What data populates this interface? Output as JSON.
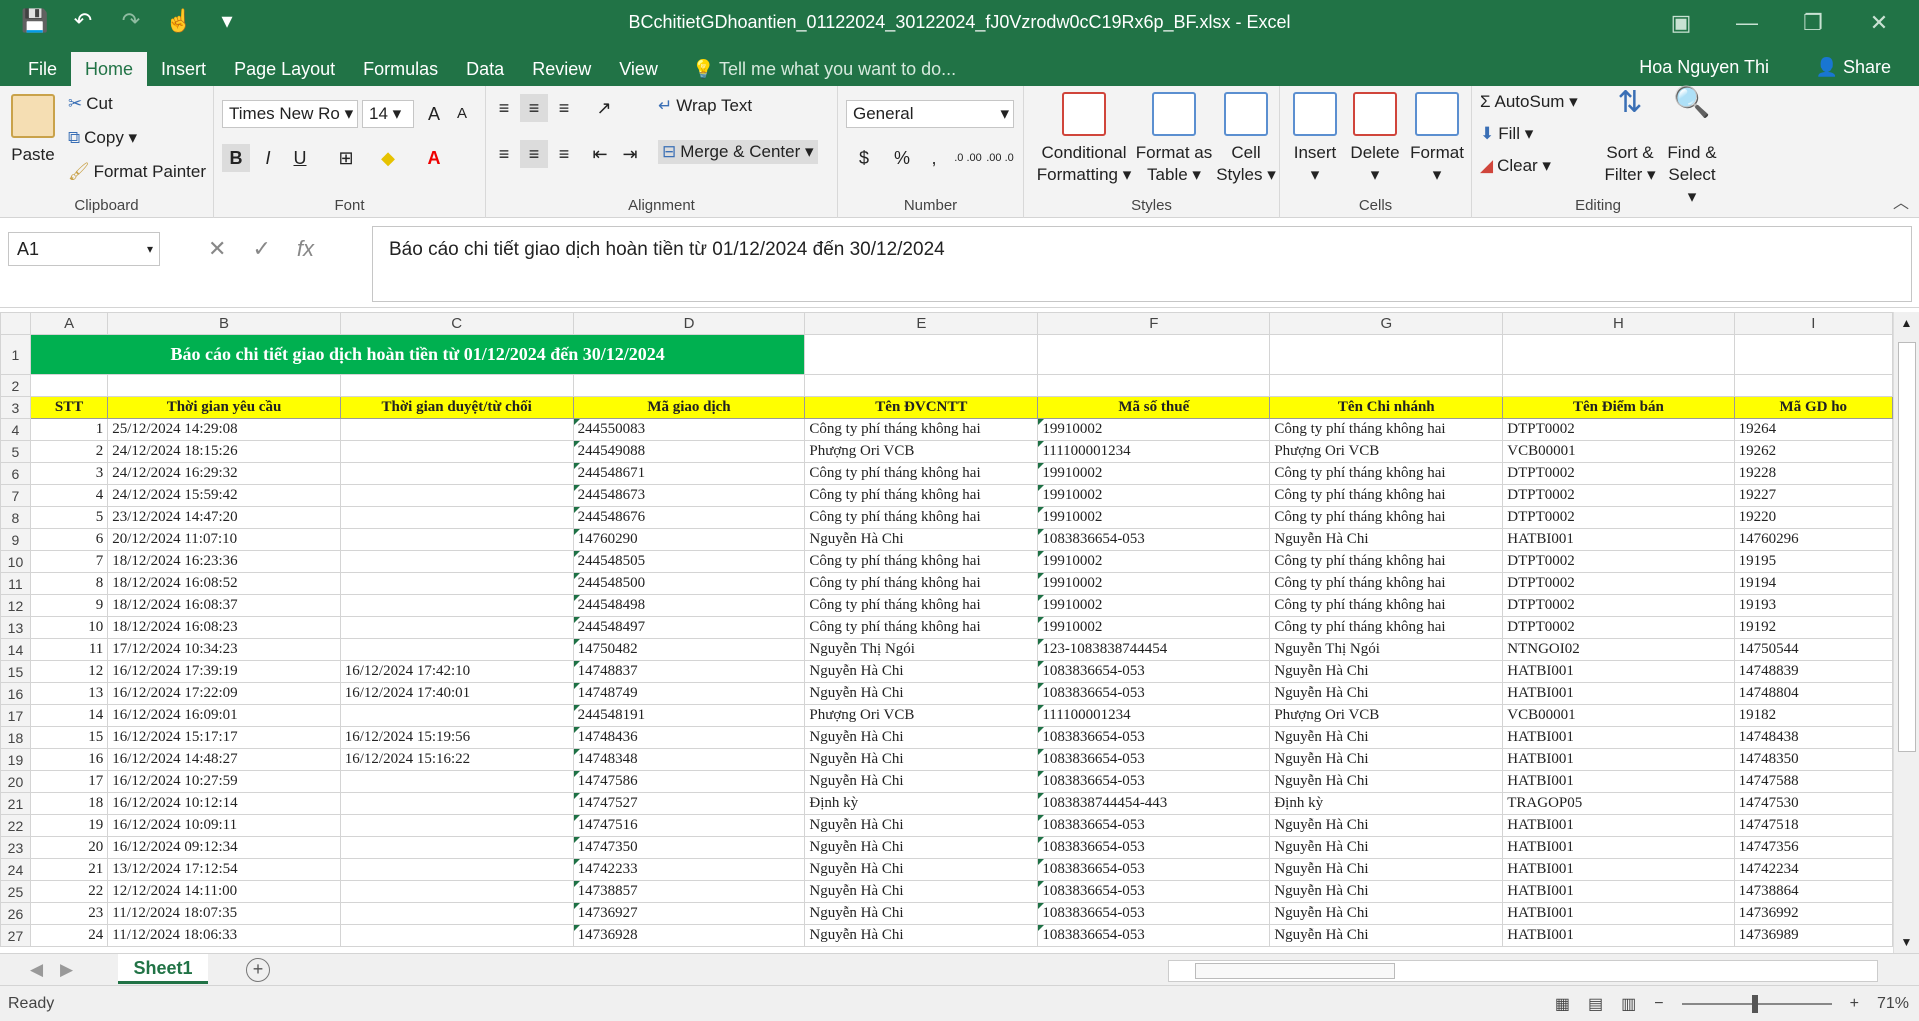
{
  "window": {
    "title": "BCchitietGDhoantien_01122024_30122024_fJ0Vzrodw0cC19Rx6p_BF.xlsx - Excel"
  },
  "qat": {
    "save_icon": "save-icon",
    "undo_icon": "undo-icon",
    "redo_icon": "redo-icon",
    "touch_icon": "touch-mode-icon",
    "customize_icon": "customize-icon"
  },
  "tabs": [
    {
      "label": "File"
    },
    {
      "label": "Home"
    },
    {
      "label": "Insert"
    },
    {
      "label": "Page Layout"
    },
    {
      "label": "Formulas"
    },
    {
      "label": "Data"
    },
    {
      "label": "Review"
    },
    {
      "label": "View"
    }
  ],
  "tell_me": "Tell me what you want to do...",
  "user": "Hoa Nguyen Thi",
  "share": "Share",
  "ribbon": {
    "clipboard": {
      "paste": "Paste",
      "cut": "Cut",
      "copy": "Copy",
      "format_painter": "Format Painter",
      "label": "Clipboard"
    },
    "font": {
      "name": "Times New Ro",
      "size": "14",
      "label": "Font",
      "bold": "B",
      "italic": "I",
      "underline": "U",
      "grow": "A",
      "shrink": "A"
    },
    "alignment": {
      "wrap": "Wrap Text",
      "merge": "Merge & Center",
      "label": "Alignment"
    },
    "number": {
      "format": "General",
      "currency": "$",
      "percent": "%",
      "comma": ",",
      "label": "Number",
      "inc_decimal": ".0 .00",
      "dec_decimal": ".00 .0"
    },
    "styles": {
      "conditional_l1": "Conditional",
      "conditional_l2": "Formatting",
      "table_l1": "Format as",
      "table_l2": "Table",
      "cell_l1": "Cell",
      "cell_l2": "Styles",
      "label": "Styles"
    },
    "cells": {
      "insert": "Insert",
      "delete": "Delete",
      "format": "Format",
      "label": "Cells"
    },
    "editing": {
      "autosum": "AutoSum",
      "fill": "Fill",
      "clear": "Clear",
      "sort_l1": "Sort &",
      "sort_l2": "Filter",
      "find_l1": "Find &",
      "find_l2": "Select",
      "label": "Editing"
    }
  },
  "formula_bar": {
    "name_box": "A1",
    "cancel": "✕",
    "enter": "✓",
    "fx": "fx",
    "value": "Báo cáo chi tiết giao dịch hoàn tiền từ 01/12/2024 đến 30/12/2024"
  },
  "sheet": {
    "columns": [
      "A",
      "B",
      "C",
      "D",
      "E",
      "F",
      "G",
      "H",
      "I"
    ],
    "banner": "Báo cáo chi tiết giao dịch hoàn tiền từ 01/12/2024 đến 30/12/2024",
    "headers": [
      "STT",
      "Thời gian yêu cầu",
      "Thời gian duyệt/từ chối",
      "Mã giao dịch",
      "Tên ĐVCNTT",
      "Mã số thuế",
      "Tên Chi nhánh",
      "Tên Điểm bán",
      "Mã GD ho"
    ],
    "rows": [
      [
        "1",
        "25/12/2024 14:29:08",
        "",
        "244550083",
        "Công ty phí tháng không hai",
        "19910002",
        "Công ty phí tháng không hai",
        "DTPT0002",
        "19264"
      ],
      [
        "2",
        "24/12/2024 18:15:26",
        "",
        "244549088",
        "Phượng Ori VCB",
        "111100001234",
        "Phượng Ori VCB",
        "VCB00001",
        "19262"
      ],
      [
        "3",
        "24/12/2024 16:29:32",
        "",
        "244548671",
        "Công ty phí tháng không hai",
        "19910002",
        "Công ty phí tháng không hai",
        "DTPT0002",
        "19228"
      ],
      [
        "4",
        "24/12/2024 15:59:42",
        "",
        "244548673",
        "Công ty phí tháng không hai",
        "19910002",
        "Công ty phí tháng không hai",
        "DTPT0002",
        "19227"
      ],
      [
        "5",
        "23/12/2024 14:47:20",
        "",
        "244548676",
        "Công ty phí tháng không hai",
        "19910002",
        "Công ty phí tháng không hai",
        "DTPT0002",
        "19220"
      ],
      [
        "6",
        "20/12/2024 11:07:10",
        "",
        "14760290",
        "Nguyễn Hà Chi",
        "1083836654-053",
        "Nguyễn Hà Chi",
        "HATBI001",
        "14760296"
      ],
      [
        "7",
        "18/12/2024 16:23:36",
        "",
        "244548505",
        "Công ty phí tháng không hai",
        "19910002",
        "Công ty phí tháng không hai",
        "DTPT0002",
        "19195"
      ],
      [
        "8",
        "18/12/2024 16:08:52",
        "",
        "244548500",
        "Công ty phí tháng không hai",
        "19910002",
        "Công ty phí tháng không hai",
        "DTPT0002",
        "19194"
      ],
      [
        "9",
        "18/12/2024 16:08:37",
        "",
        "244548498",
        "Công ty phí tháng không hai",
        "19910002",
        "Công ty phí tháng không hai",
        "DTPT0002",
        "19193"
      ],
      [
        "10",
        "18/12/2024 16:08:23",
        "",
        "244548497",
        "Công ty phí tháng không hai",
        "19910002",
        "Công ty phí tháng không hai",
        "DTPT0002",
        "19192"
      ],
      [
        "11",
        "17/12/2024 10:34:23",
        "",
        "14750482",
        "Nguyễn Thị Ngói",
        "123-1083838744454",
        "Nguyễn Thị Ngói",
        "NTNGOI02",
        "14750544"
      ],
      [
        "12",
        "16/12/2024 17:39:19",
        "16/12/2024 17:42:10",
        "14748837",
        "Nguyễn Hà Chi",
        "1083836654-053",
        "Nguyễn Hà Chi",
        "HATBI001",
        "14748839"
      ],
      [
        "13",
        "16/12/2024 17:22:09",
        "16/12/2024 17:40:01",
        "14748749",
        "Nguyễn Hà Chi",
        "1083836654-053",
        "Nguyễn Hà Chi",
        "HATBI001",
        "14748804"
      ],
      [
        "14",
        "16/12/2024 16:09:01",
        "",
        "244548191",
        "Phượng Ori VCB",
        "111100001234",
        "Phượng Ori VCB",
        "VCB00001",
        "19182"
      ],
      [
        "15",
        "16/12/2024 15:17:17",
        "16/12/2024 15:19:56",
        "14748436",
        "Nguyễn Hà Chi",
        "1083836654-053",
        "Nguyễn Hà Chi",
        "HATBI001",
        "14748438"
      ],
      [
        "16",
        "16/12/2024 14:48:27",
        "16/12/2024 15:16:22",
        "14748348",
        "Nguyễn Hà Chi",
        "1083836654-053",
        "Nguyễn Hà Chi",
        "HATBI001",
        "14748350"
      ],
      [
        "17",
        "16/12/2024 10:27:59",
        "",
        "14747586",
        "Nguyễn Hà Chi",
        "1083836654-053",
        "Nguyễn Hà Chi",
        "HATBI001",
        "14747588"
      ],
      [
        "18",
        "16/12/2024 10:12:14",
        "",
        "14747527",
        "Định kỳ",
        "1083838744454-443",
        "Định kỳ",
        "TRAGOP05",
        "14747530"
      ],
      [
        "19",
        "16/12/2024 10:09:11",
        "",
        "14747516",
        "Nguyễn Hà Chi",
        "1083836654-053",
        "Nguyễn Hà Chi",
        "HATBI001",
        "14747518"
      ],
      [
        "20",
        "16/12/2024 09:12:34",
        "",
        "14747350",
        "Nguyễn Hà Chi",
        "1083836654-053",
        "Nguyễn Hà Chi",
        "HATBI001",
        "14747356"
      ],
      [
        "21",
        "13/12/2024 17:12:54",
        "",
        "14742233",
        "Nguyễn Hà Chi",
        "1083836654-053",
        "Nguyễn Hà Chi",
        "HATBI001",
        "14742234"
      ],
      [
        "22",
        "12/12/2024 14:11:00",
        "",
        "14738857",
        "Nguyễn Hà Chi",
        "1083836654-053",
        "Nguyễn Hà Chi",
        "HATBI001",
        "14738864"
      ],
      [
        "23",
        "11/12/2024 18:07:35",
        "",
        "14736927",
        "Nguyễn Hà Chi",
        "1083836654-053",
        "Nguyễn Hà Chi",
        "HATBI001",
        "14736992"
      ],
      [
        "24",
        "11/12/2024 18:06:33",
        "",
        "14736928",
        "Nguyễn Hà Chi",
        "1083836654-053",
        "Nguyễn Hà Chi",
        "HATBI001",
        "14736989"
      ]
    ],
    "tab": "Sheet1"
  },
  "status": {
    "ready": "Ready",
    "zoom": "71%"
  }
}
